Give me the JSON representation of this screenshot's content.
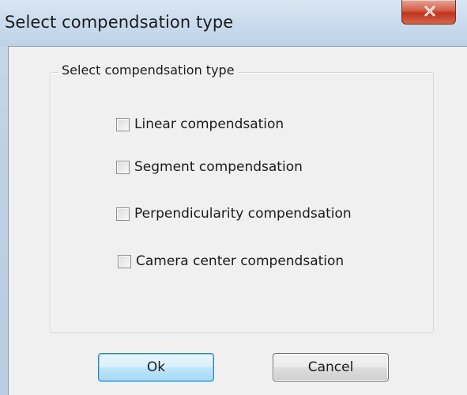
{
  "window": {
    "title": "Select compendsation type",
    "close_icon": "close-icon"
  },
  "group": {
    "label": "Select compendsation type",
    "options": [
      {
        "label": "Linear compendsation",
        "checked": false
      },
      {
        "label": "Segment compendsation",
        "checked": false
      },
      {
        "label": "Perpendicularity compendsation",
        "checked": false
      },
      {
        "label": "Camera center compendsation",
        "checked": false
      }
    ]
  },
  "buttons": {
    "ok_label": "Ok",
    "cancel_label": "Cancel"
  },
  "colors": {
    "titlebar": "#c9d9ea",
    "close_button": "#c2321c",
    "client_background": "#f0f0f0",
    "default_button_border": "#3c7fb1"
  }
}
